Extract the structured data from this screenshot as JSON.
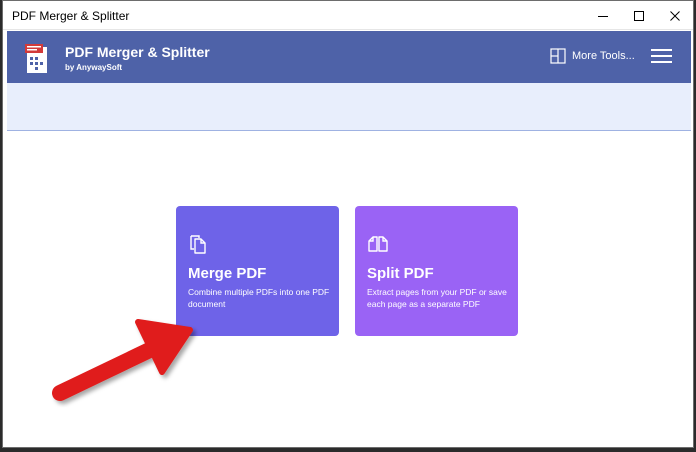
{
  "window": {
    "title": "PDF Merger & Splitter"
  },
  "header": {
    "app_title": "PDF Merger & Splitter",
    "app_subtitle": "by AnywaySoft",
    "more_tools_label": "More Tools...",
    "background_color": "#4e62a8"
  },
  "cards": [
    {
      "title": "Merge PDF",
      "description": "Combine multiple PDFs into one PDF document",
      "icon": "copy-documents-icon",
      "color": "#6e63e8"
    },
    {
      "title": "Split PDF",
      "description": "Extract pages from your PDF or save each page as a separate PDF",
      "icon": "split-documents-icon",
      "color": "#9a63f5"
    }
  ],
  "annotation": {
    "arrow_color": "#e01b1b",
    "points_to": "Merge PDF"
  }
}
